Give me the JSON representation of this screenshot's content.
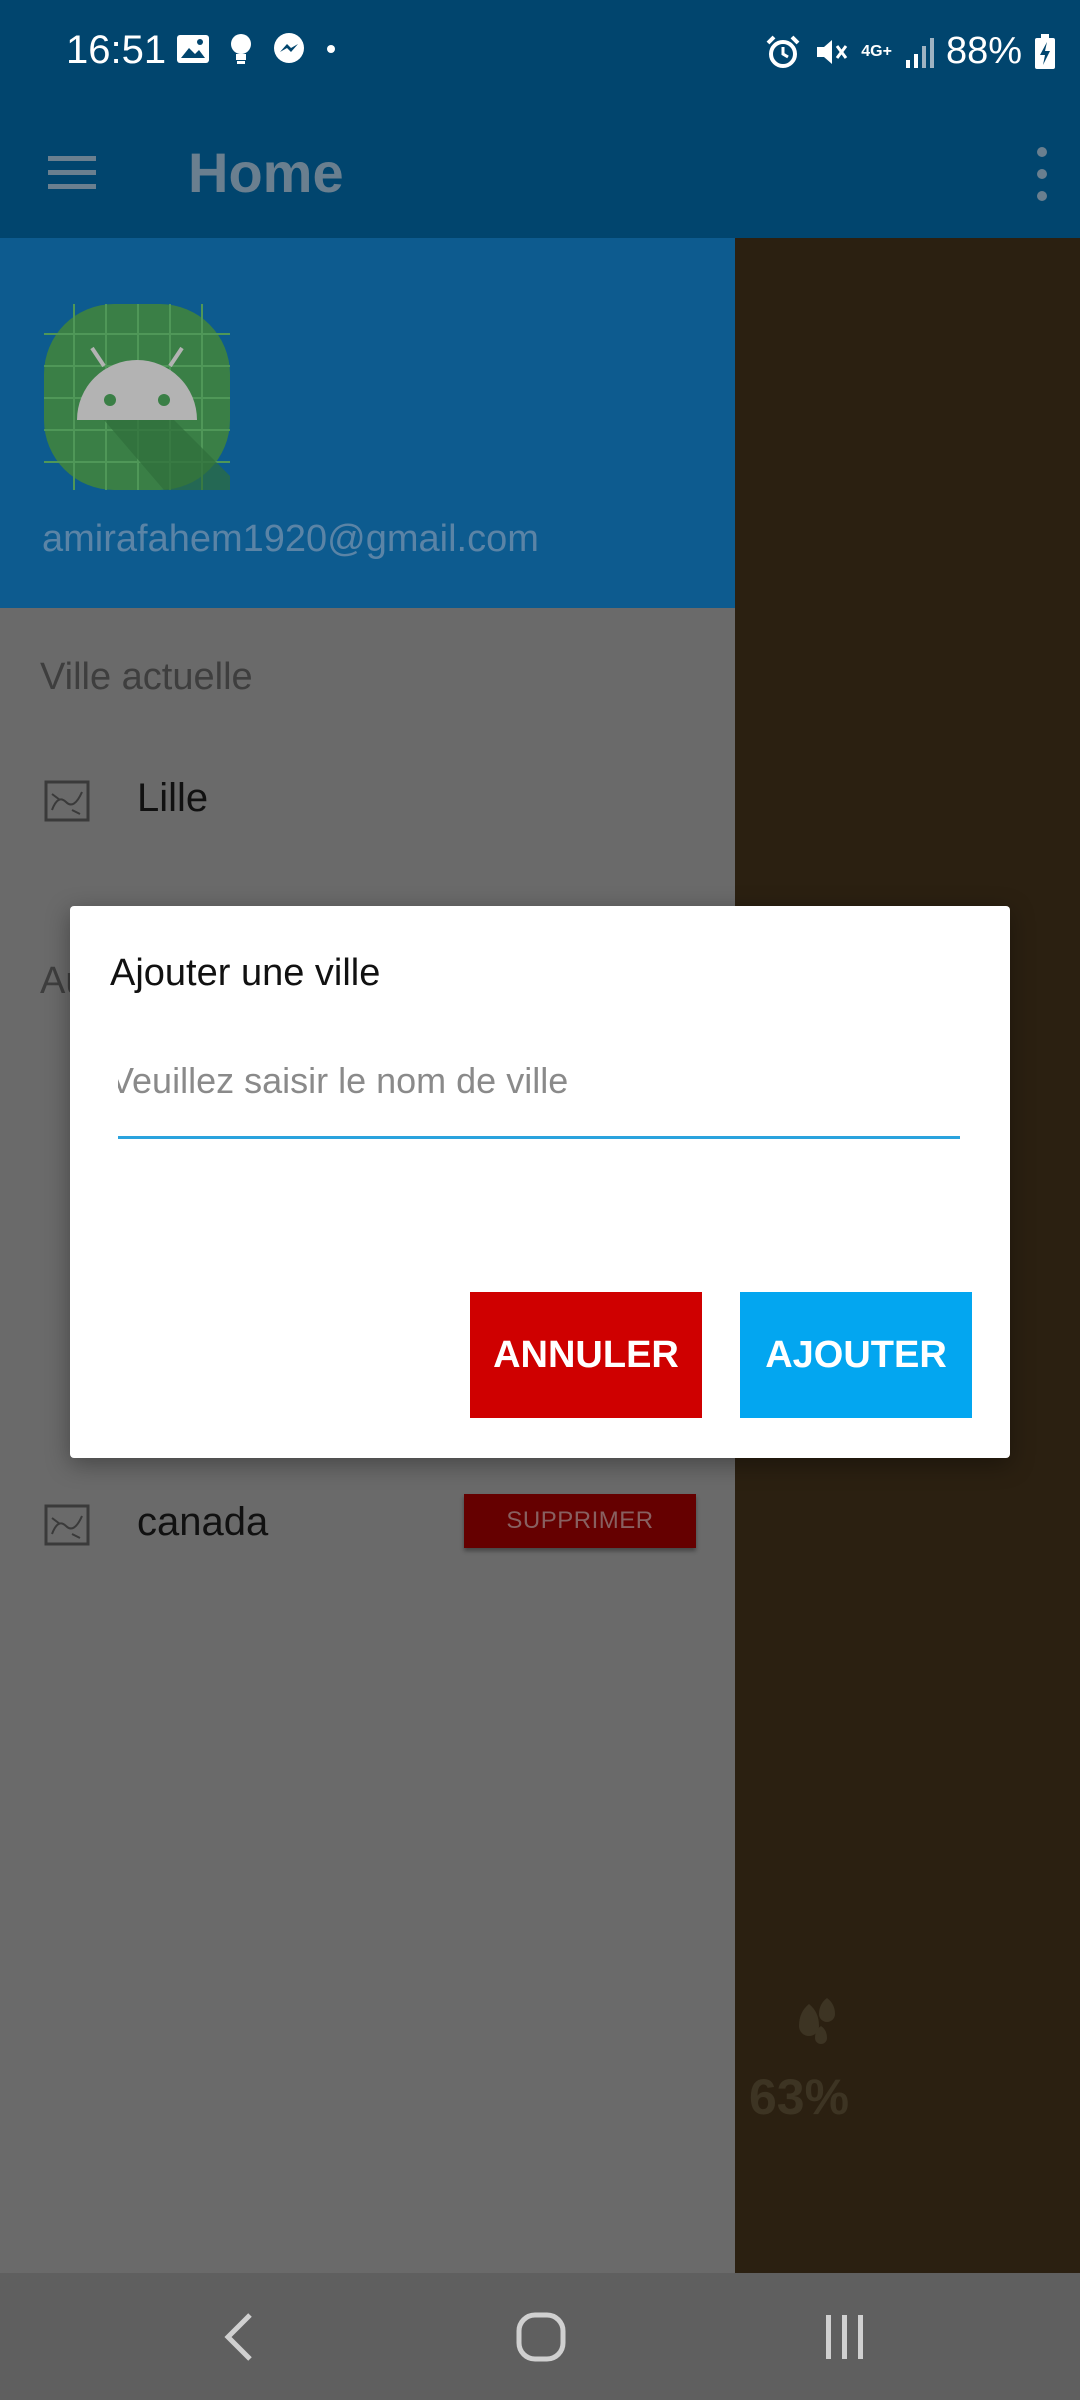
{
  "status_bar": {
    "time": "16:51",
    "battery": "88%",
    "network": "4G+",
    "icons": [
      "gallery-icon",
      "bulb-icon",
      "messenger-icon",
      "dot-icon",
      "alarm-icon",
      "mute-icon",
      "signal-icon",
      "battery-charging-icon"
    ]
  },
  "app_bar": {
    "title": "Home",
    "menu_icon": "hamburger-menu-icon",
    "overflow_icon": "more-vert-icon"
  },
  "drawer": {
    "avatar_icon": "android-avatar-icon",
    "email": "amirafahem1920@gmail.com",
    "current_city_section": "Ville actuelle",
    "current_city": "Lille",
    "other_section_partial": "Au",
    "cities": [
      {
        "name": "canada",
        "delete_label": "SUPPRIMER"
      }
    ]
  },
  "background": {
    "humidity_value": "63%"
  },
  "dialog": {
    "title": "Ajouter une ville",
    "input_placeholder": "Veuillez saisir le nom de ville",
    "input_value": "",
    "cancel_label": "ANNULER",
    "add_label": "AJOUTER"
  },
  "colors": {
    "status_bar": "#01456e",
    "drawer_header": "#0d5b8f",
    "cancel_button": "#cf0000",
    "add_button": "#03a6f0",
    "input_underline": "#2aa3de"
  }
}
